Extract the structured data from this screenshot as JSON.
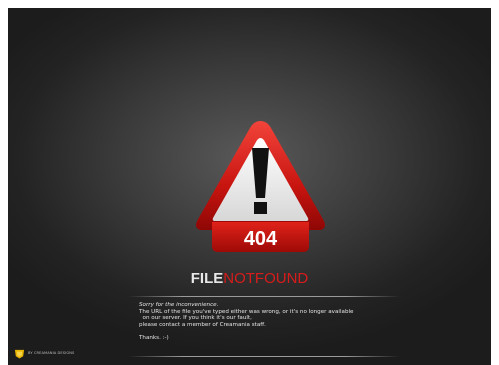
{
  "error": {
    "code": "404",
    "title_parts": [
      "FILE",
      "NOT",
      "FOUND"
    ]
  },
  "message": {
    "apology": "Sorry for the inconvenience.",
    "lines": [
      "The URL of the file you've typed either was wrong, or it's no longer available",
      "  on our server. If you think it's our fault,",
      "please contact a member of Creamania staff."
    ],
    "thanks": "Thanks. :-)"
  },
  "brand": {
    "name": "BY CREAMANIA DESIGNS"
  },
  "colors": {
    "accent": "#d81b1b",
    "background": "#2a2a2a",
    "text": "#e6e6e6"
  },
  "icons": [
    "warning-triangle-icon",
    "creamania-logo-icon"
  ]
}
